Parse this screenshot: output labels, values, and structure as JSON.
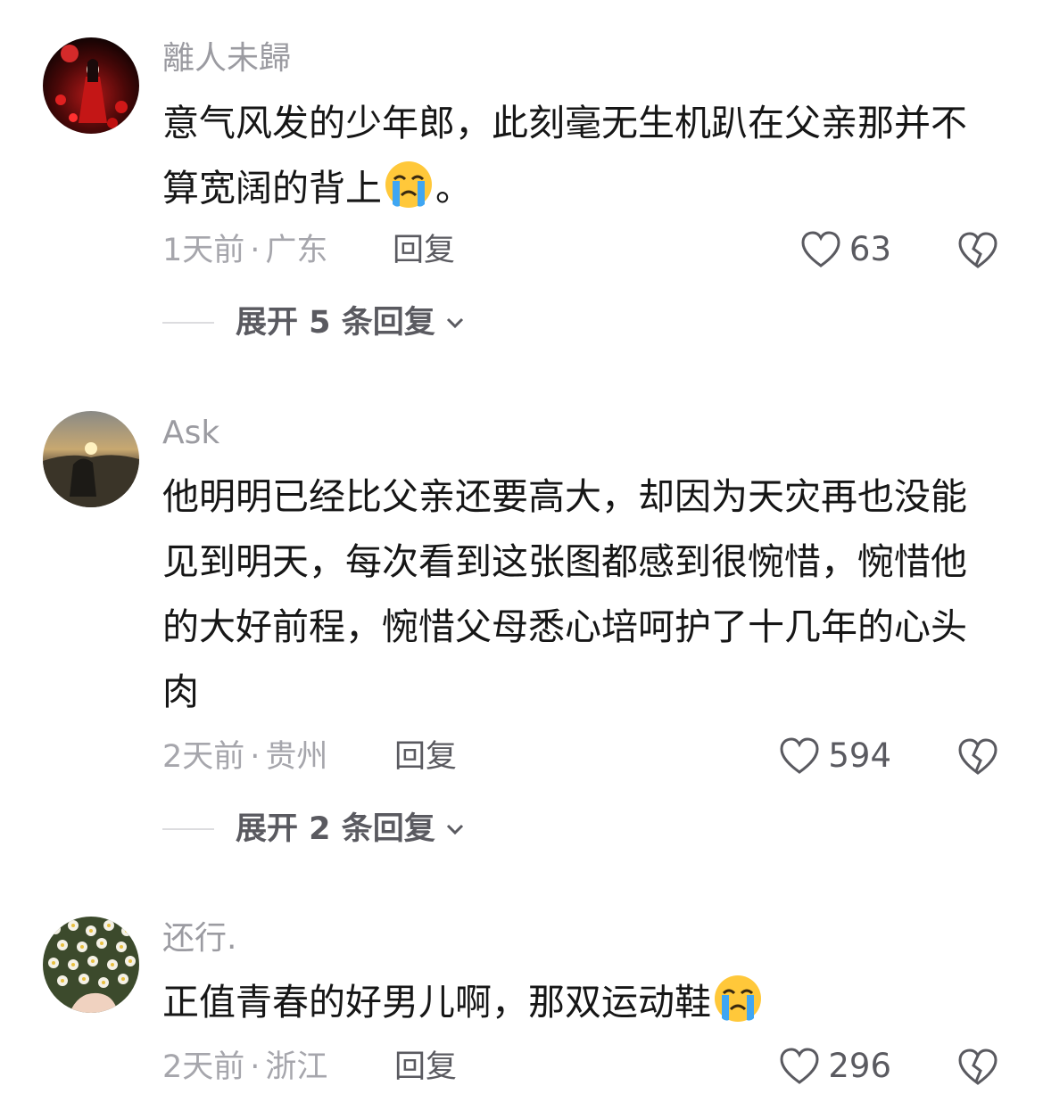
{
  "comments": [
    {
      "username": "離人未歸",
      "text_before_emoji": "意气风发的少年郎，此刻毫无生机趴在父亲那并不算宽阔的背上",
      "text_after_emoji": "。",
      "emoji": "crying-face",
      "time": "1天前",
      "dot": "·",
      "location": "广东",
      "reply_label": "回复",
      "likes": "63",
      "expand_label": "展开 5 条回复"
    },
    {
      "username": "Ask",
      "text_before_emoji": "他明明已经比父亲还要高大，却因为天灾再也没能见到明天，每次看到这张图都感到很惋惜，惋惜他的大好前程，惋惜父母悉心培呵护了十几年的心头肉",
      "text_after_emoji": "",
      "emoji": "",
      "time": "2天前",
      "dot": "·",
      "location": "贵州",
      "reply_label": "回复",
      "likes": "594",
      "expand_label": "展开 2 条回复"
    },
    {
      "username": "还行.",
      "text_before_emoji": "正值青春的好男儿啊，那双运动鞋",
      "text_after_emoji": "",
      "emoji": "crying-face",
      "time": "2天前",
      "dot": "·",
      "location": "浙江",
      "reply_label": "回复",
      "likes": "296",
      "expand_label": ""
    }
  ],
  "colors": {
    "username": "#9b9ba1",
    "text": "#161616",
    "meta": "#a6a6ac",
    "action": "#5a5a60"
  }
}
